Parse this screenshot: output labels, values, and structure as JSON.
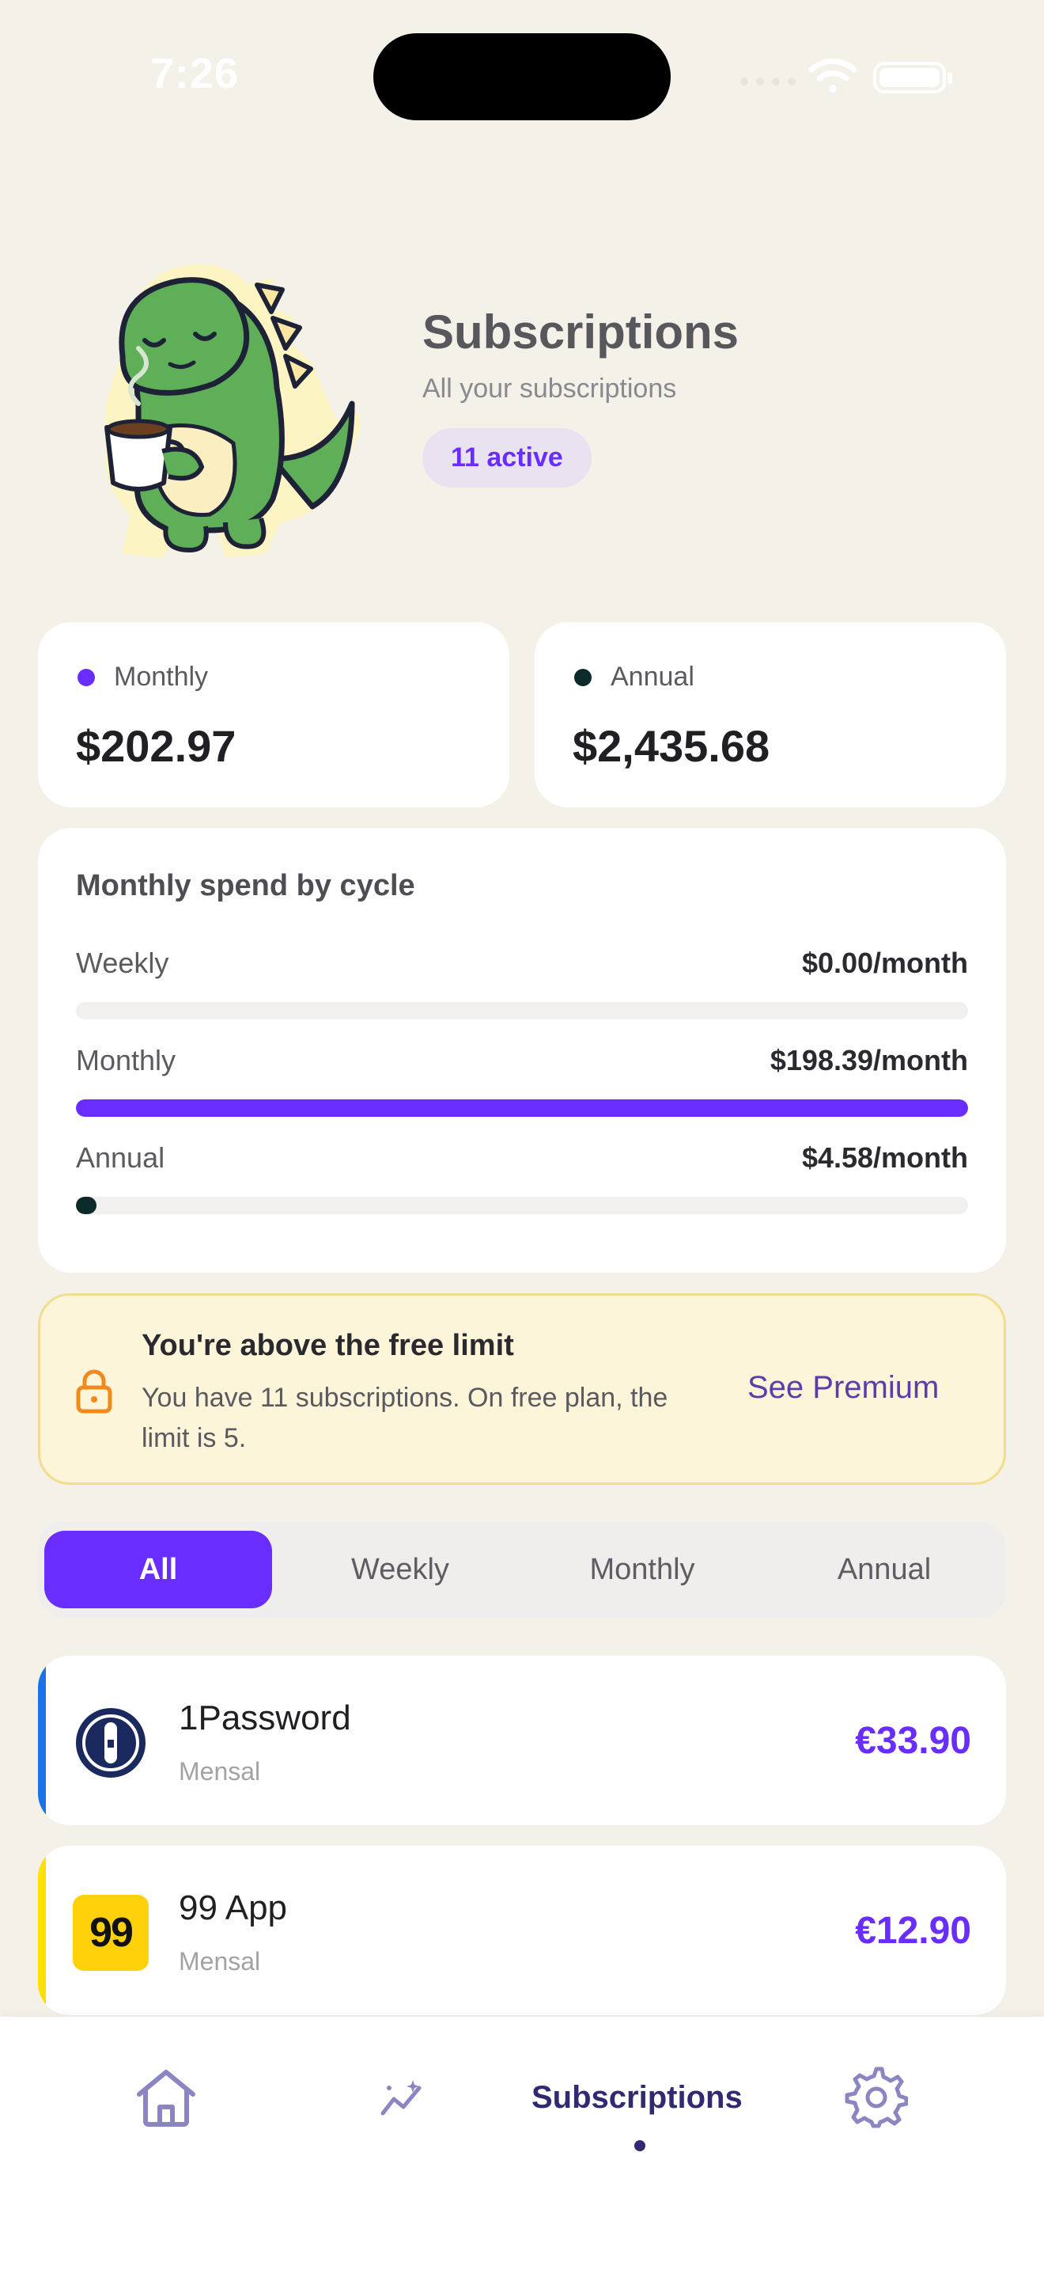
{
  "status": {
    "time": "7:26"
  },
  "hero": {
    "title": "Subscriptions",
    "subtitle": "All your subscriptions",
    "badge": "11 active"
  },
  "totals": [
    {
      "label": "Monthly",
      "value": "$202.97",
      "color": "#6a2dff"
    },
    {
      "label": "Annual",
      "value": "$2,435.68",
      "color": "#0d2a2a"
    }
  ],
  "spend": {
    "title": "Monthly spend by cycle",
    "rows": [
      {
        "label": "Weekly",
        "amount": "$0.00/month",
        "fraction": 0.0,
        "color": "#6a2dff"
      },
      {
        "label": "Monthly",
        "amount": "$198.39/month",
        "fraction": 1.0,
        "color": "#6a2dff"
      },
      {
        "label": "Annual",
        "amount": "$4.58/month",
        "fraction": 0.023,
        "color": "#0d2a2a"
      }
    ]
  },
  "limit": {
    "title": "You're above the free limit",
    "text": "You have 11 subscriptions. On free plan, the limit is 5.",
    "cta": "See Premium"
  },
  "tabs": [
    {
      "label": "All",
      "active": true
    },
    {
      "label": "Weekly",
      "active": false
    },
    {
      "label": "Monthly",
      "active": false
    },
    {
      "label": "Annual",
      "active": false
    }
  ],
  "subscriptions": [
    {
      "name": "1Password",
      "cycle": "Mensal",
      "price": "€33.90",
      "accent": "#1a73e8",
      "logo": "onepassword-logo-icon"
    },
    {
      "name": "99 App",
      "cycle": "Mensal",
      "price": "€12.90",
      "accent": "#ffe000",
      "logo": "ninety-nine-logo-icon",
      "logo_text": "99"
    }
  ],
  "nav": {
    "items": [
      "home-icon",
      "analytics-icon",
      "subscriptions",
      "settings-icon"
    ],
    "active_label": "Subscriptions"
  }
}
